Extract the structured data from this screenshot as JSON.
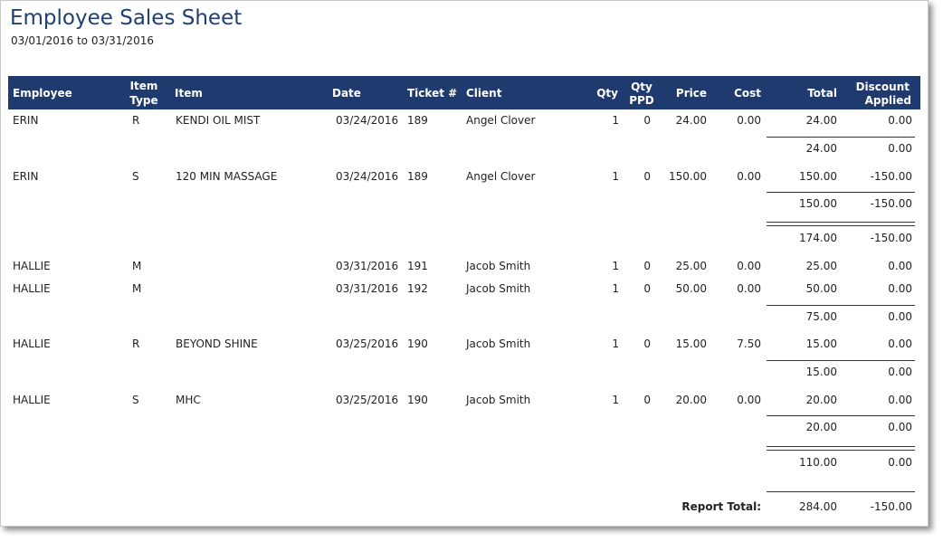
{
  "report": {
    "title": "Employee Sales Sheet",
    "date_range": "03/01/2016 to 03/31/2016"
  },
  "columns": {
    "employee": "Employee",
    "item_type_1": "Item",
    "item_type_2": "Type",
    "item": "Item",
    "date": "Date",
    "ticket": "Ticket #",
    "client": "Client",
    "qty": "Qty",
    "qty_ppd_1": "Qty",
    "qty_ppd_2": "PPD",
    "price": "Price",
    "cost": "Cost",
    "total": "Total",
    "discount_1": "Discount",
    "discount_2": "Applied"
  },
  "rows": [
    {
      "employee": "ERIN",
      "type": "R",
      "item": "KENDI OIL MIST",
      "date": "03/24/2016",
      "ticket": "189",
      "client": "Angel Clover",
      "qty": "1",
      "qty_ppd": "0",
      "price": "24.00",
      "cost": "0.00",
      "total": "24.00",
      "discount": "0.00"
    },
    {
      "employee": "ERIN",
      "type": "S",
      "item": "120 MIN MASSAGE",
      "date": "03/24/2016",
      "ticket": "189",
      "client": "Angel Clover",
      "qty": "1",
      "qty_ppd": "0",
      "price": "150.00",
      "cost": "0.00",
      "total": "150.00",
      "discount": "-150.00"
    },
    {
      "employee": "HALLIE",
      "type": "M",
      "item": "",
      "date": "03/31/2016",
      "ticket": "191",
      "client": "Jacob Smith",
      "qty": "1",
      "qty_ppd": "0",
      "price": "25.00",
      "cost": "0.00",
      "total": "25.00",
      "discount": "0.00"
    },
    {
      "employee": "HALLIE",
      "type": "M",
      "item": "",
      "date": "03/31/2016",
      "ticket": "192",
      "client": "Jacob Smith",
      "qty": "1",
      "qty_ppd": "0",
      "price": "50.00",
      "cost": "0.00",
      "total": "50.00",
      "discount": "0.00"
    },
    {
      "employee": "HALLIE",
      "type": "R",
      "item": "BEYOND SHINE",
      "date": "03/25/2016",
      "ticket": "190",
      "client": "Jacob Smith",
      "qty": "1",
      "qty_ppd": "0",
      "price": "15.00",
      "cost": "7.50",
      "total": "15.00",
      "discount": "0.00"
    },
    {
      "employee": "HALLIE",
      "type": "S",
      "item": "MHC",
      "date": "03/25/2016",
      "ticket": "190",
      "client": "Jacob Smith",
      "qty": "1",
      "qty_ppd": "0",
      "price": "20.00",
      "cost": "0.00",
      "total": "20.00",
      "discount": "0.00"
    }
  ],
  "subtotals": [
    {
      "total": "24.00",
      "discount": "0.00"
    },
    {
      "total": "150.00",
      "discount": "-150.00"
    },
    {
      "total": "75.00",
      "discount": "0.00"
    },
    {
      "total": "15.00",
      "discount": "0.00"
    },
    {
      "total": "20.00",
      "discount": "0.00"
    }
  ],
  "employee_totals": [
    {
      "total": "174.00",
      "discount": "-150.00"
    },
    {
      "total": "110.00",
      "discount": "0.00"
    }
  ],
  "report_total": {
    "label": "Report Total:",
    "total": "284.00",
    "discount": "-150.00"
  }
}
